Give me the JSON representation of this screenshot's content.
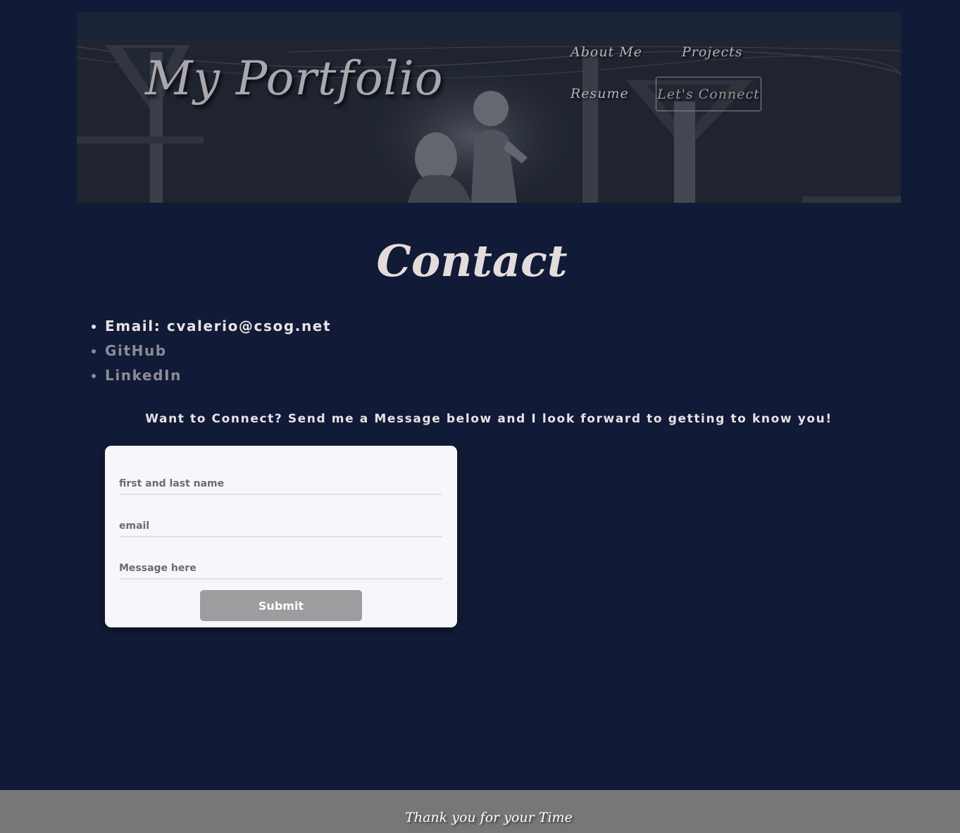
{
  "header": {
    "brand": "My Portfolio",
    "nav": [
      {
        "label": "About Me"
      },
      {
        "label": "Projects"
      },
      {
        "label": "Resume"
      },
      {
        "label": "Let's Connect"
      }
    ]
  },
  "page": {
    "title": "Contact"
  },
  "contact": {
    "email": "Email: cvalerio@csog.net",
    "github": "GitHub",
    "linkedin": "LinkedIn"
  },
  "intro": "Want to Connect? Send me a Message below and I look forward to getting to know you!",
  "form": {
    "name_placeholder": "first and last name",
    "email_placeholder": "email",
    "message_placeholder": "Message here",
    "submit_label": "Submit"
  },
  "footer": {
    "text": "Thank you for your Time"
  },
  "colors": {
    "background": "#111a36",
    "footer": "#777777",
    "submit": "#9d9c9f",
    "card": "#f8f6fb"
  }
}
